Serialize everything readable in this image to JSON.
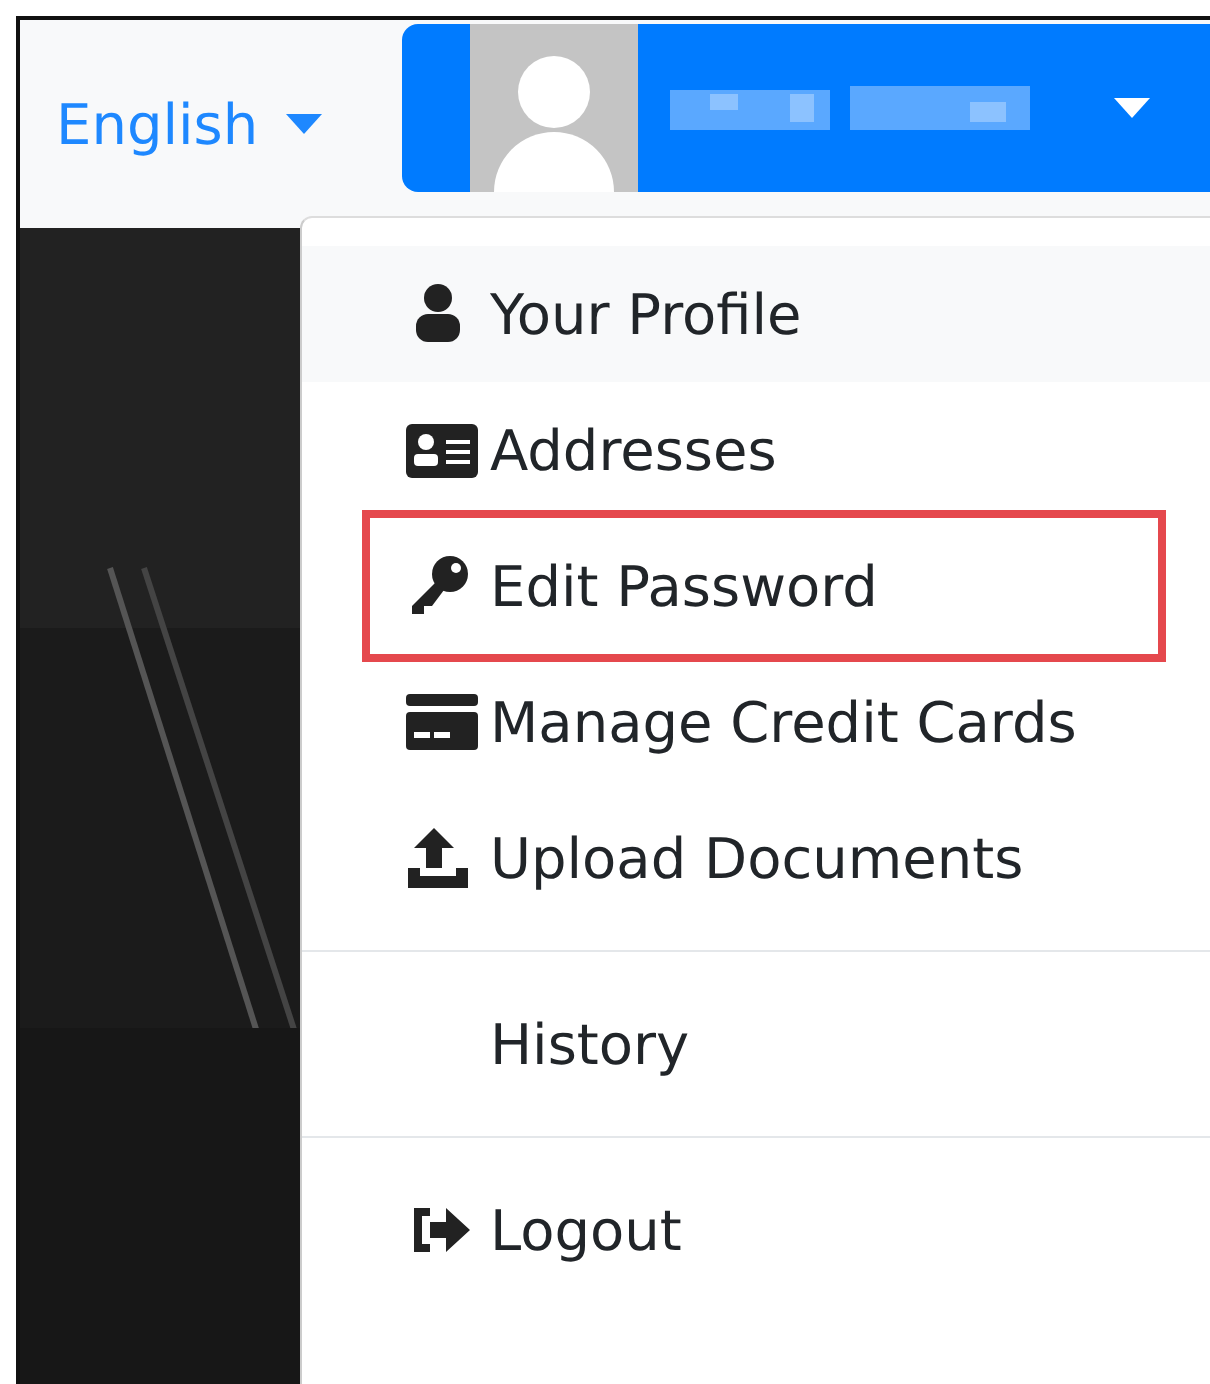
{
  "navbar": {
    "language": {
      "label": "English"
    }
  },
  "user_menu": {
    "expanded": true
  },
  "dropdown": {
    "sections": [
      {
        "items": [
          {
            "label": "Your Profile",
            "hovered": true,
            "highlighted": false
          },
          {
            "label": "Addresses",
            "hovered": false,
            "highlighted": false
          },
          {
            "label": "Edit Password",
            "hovered": false,
            "highlighted": true
          },
          {
            "label": "Manage Credit Cards",
            "hovered": false,
            "highlighted": false
          },
          {
            "label": "Upload Documents",
            "hovered": false,
            "highlighted": false
          }
        ]
      },
      {
        "items": [
          {
            "label": "History",
            "hovered": false,
            "highlighted": false
          }
        ]
      },
      {
        "items": [
          {
            "label": "Logout",
            "hovered": false,
            "highlighted": false
          }
        ]
      }
    ]
  }
}
